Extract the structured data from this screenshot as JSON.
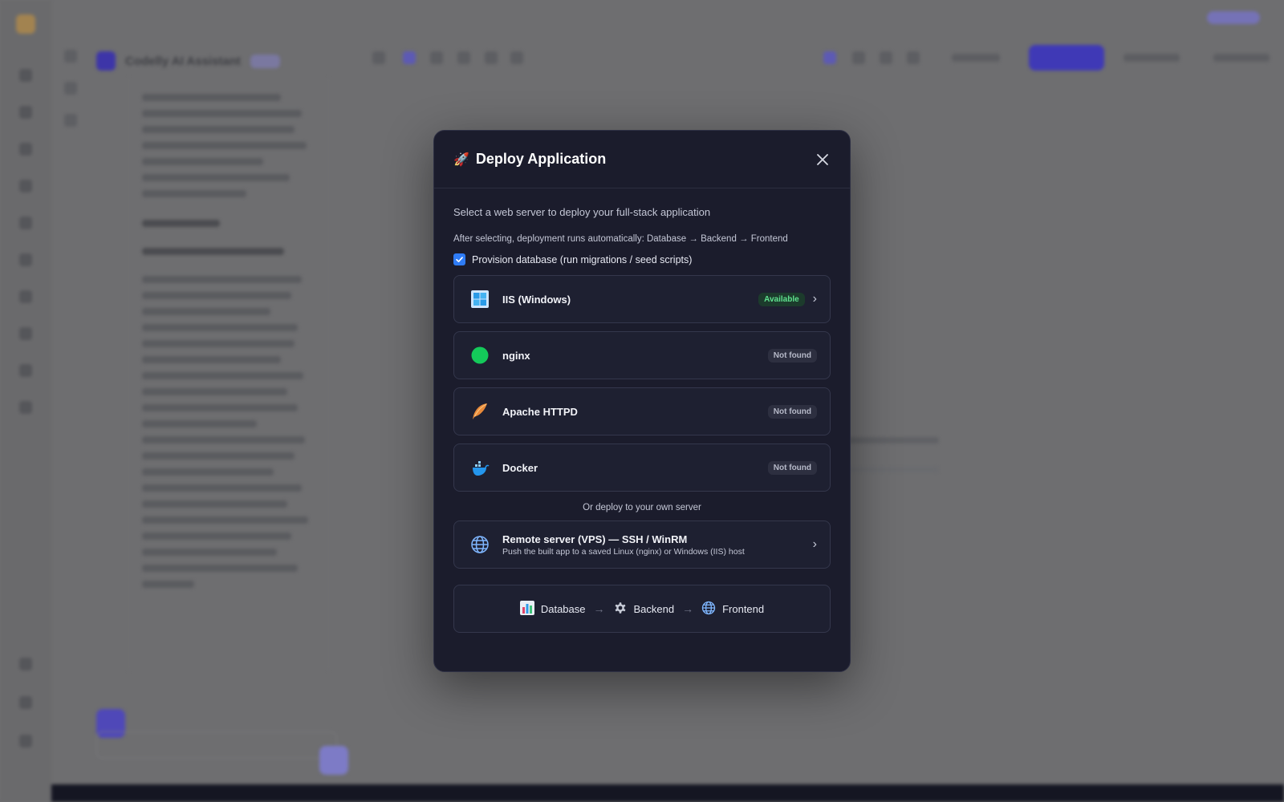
{
  "modal": {
    "title": "Deploy Application",
    "subtitle": "Select a web server to deploy your full-stack application",
    "note": "After selecting, deployment runs automatically: Database → Backend → Frontend",
    "provision": {
      "label": "Provision database (run migrations / seed scripts)",
      "checked": true
    },
    "servers": [
      {
        "name": "IIS (Windows)",
        "status": "Available",
        "icon": "windows-icon"
      },
      {
        "name": "nginx",
        "status": "Not found",
        "icon": "nginx-dot-icon"
      },
      {
        "name": "Apache HTTPD",
        "status": "Not found",
        "icon": "apache-feather-icon"
      },
      {
        "name": "Docker",
        "status": "Not found",
        "icon": "docker-whale-icon"
      }
    ],
    "or_label": "Or deploy to your own server",
    "remote": {
      "title": "Remote server (VPS) — SSH / WinRM",
      "subtitle": "Push the built app to a saved Linux (nginx) or Windows (IIS) host"
    },
    "pipeline": {
      "steps": [
        "Database",
        "Backend",
        "Frontend"
      ],
      "arrow": "→"
    }
  },
  "background": {
    "chat_title": "Codelly AI Assistant"
  },
  "colors": {
    "modal_bg": "#1b1c2c",
    "accent": "#2f7cf6",
    "available": "#5fe28f",
    "nginx_green": "#14c95a",
    "apache_orange": "#e98a3a",
    "docker_blue": "#2496ed"
  }
}
